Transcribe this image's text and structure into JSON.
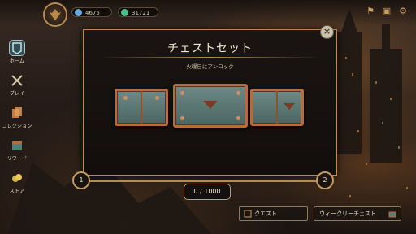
{
  "topbar": {
    "currency_1": {
      "value": "4675",
      "icon": "blue-gem-icon",
      "color": "#6aa6d6"
    },
    "currency_2": {
      "value": "31721",
      "icon": "green-shard-icon",
      "color": "#4fbf8a"
    },
    "icons": [
      "wishlist-icon",
      "inbox-icon",
      "settings-icon"
    ]
  },
  "sidebar": {
    "items": [
      {
        "label": "ホーム",
        "icon": "home-icon",
        "active": true
      },
      {
        "label": "プレイ",
        "icon": "play-icon",
        "active": false
      },
      {
        "label": "コレクション",
        "icon": "collection-icon",
        "active": false
      },
      {
        "label": "リワード",
        "icon": "rewards-icon",
        "active": false
      },
      {
        "label": "ストア",
        "icon": "store-icon",
        "active": false
      }
    ]
  },
  "modal": {
    "title": "チェストセット",
    "subtitle": "火曜日にアンロック",
    "close_icon": "close-icon",
    "chests": [
      "chest-icon",
      "chest-icon",
      "chest-icon"
    ]
  },
  "progress": {
    "node_start": "1",
    "node_end": "2",
    "value_text": "0 / 1000",
    "current": 0,
    "max": 1000
  },
  "buttons": {
    "quest": "クエスト",
    "weekly_chest": "ウィークリーチェスト"
  },
  "colors": {
    "accent_gold": "#b78a50",
    "chest_teal": "#6c8a86",
    "chest_copper": "#b46d3e"
  }
}
